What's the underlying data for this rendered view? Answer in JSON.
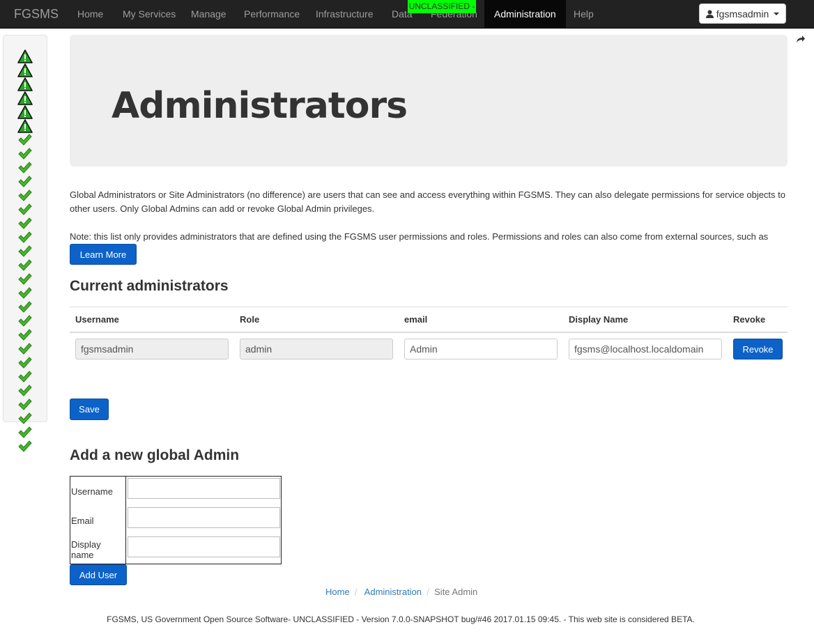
{
  "navbar": {
    "brand": "FGSMS",
    "items": [
      "Home",
      "My Services",
      "Manage",
      "Performance",
      "Infrastructure",
      "Data",
      "Federation",
      "Administration",
      "Help"
    ],
    "active": "Administration",
    "classification": "UNCLASSIFIED -",
    "user": "fgsmsadmin"
  },
  "sidebar": {
    "status_icons": [
      "warning-icon",
      "warning-icon",
      "warning-icon",
      "warning-icon",
      "warning-icon",
      "warning-icon",
      "check-icon",
      "check-icon",
      "check-icon",
      "check-icon",
      "check-icon",
      "check-icon",
      "check-icon",
      "check-icon",
      "check-icon",
      "check-icon",
      "check-icon",
      "check-icon",
      "check-icon",
      "check-icon",
      "check-icon",
      "check-icon",
      "check-icon",
      "check-icon",
      "check-icon",
      "check-icon",
      "check-icon",
      "check-icon",
      "check-icon"
    ]
  },
  "page": {
    "title": "Administrators",
    "description": "Global Administrators or Site Administrators (no difference) are users that can see and access everything within FGSMS. They can also delegate permissions for service objects to other users. Only Global Admins can add or revoke Global Admin privileges.",
    "note": "Note: this list only provides administrators that are defined using the FGSMS user permissions and roles. Permissions and roles can also come from external sources, such as LDAP.",
    "learn_more": "Learn More",
    "current_heading": "Current administrators",
    "save": "Save",
    "add_heading": "Add a new global Admin",
    "add_user": "Add User"
  },
  "admins_table": {
    "headers": [
      "Username",
      "Role",
      "email",
      "Display Name",
      "Revoke"
    ],
    "rows": [
      {
        "username": "fgsmsadmin",
        "role": "admin",
        "email": "Admin",
        "display_name": "fgsms@localhost.localdomain",
        "revoke": "Revoke"
      }
    ]
  },
  "add_form": {
    "labels": [
      "Username",
      "Email",
      "Display name"
    ],
    "values": [
      "",
      "",
      ""
    ]
  },
  "breadcrumb": [
    "Home",
    "Administration",
    "Site Admin"
  ],
  "footer": "FGSMS, US Government Open Source Software- UNCLASSIFIED - Version 7.0.0-SNAPSHOT bug/#46 2017.01.15 09:45. - This web site is considered BETA.",
  "colors": {
    "navbar": "#222222",
    "classification": "#00ff00",
    "primary": "#0c62c8",
    "warning_fill": "#22aa22",
    "check_fill": "#44b82a"
  }
}
